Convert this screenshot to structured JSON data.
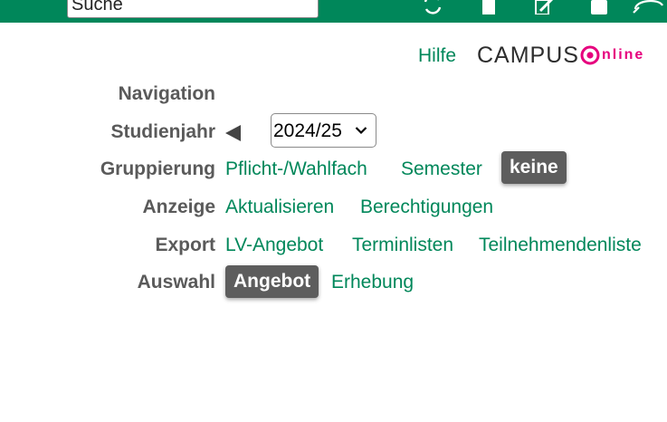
{
  "topbar": {
    "search_value": "Suche"
  },
  "help_label": "Hilfe",
  "logo": {
    "text": "CAMPUS",
    "suffix": "nline"
  },
  "navigation_label": "Navigation",
  "studienjahr": {
    "label": "Studienjahr",
    "selected": "2024/25"
  },
  "gruppierung": {
    "label": "Gruppierung",
    "options": [
      "Pflicht-/Wahlfach",
      "Semester"
    ],
    "active": "keine"
  },
  "anzeige": {
    "label": "Anzeige",
    "links": [
      "Aktualisieren",
      "Berechtigungen"
    ]
  },
  "export": {
    "label": "Export",
    "links": [
      "LV-Angebot",
      "Terminlisten",
      "Teilnehmendenliste"
    ]
  },
  "auswahl": {
    "label": "Auswahl",
    "active": "Angebot",
    "other": "Erhebung"
  },
  "colors": {
    "brand_green": "#00875a",
    "logo_pink": "#e6007e",
    "label_gray": "#5a5a5a",
    "pill_gray": "#5d5d5d"
  }
}
